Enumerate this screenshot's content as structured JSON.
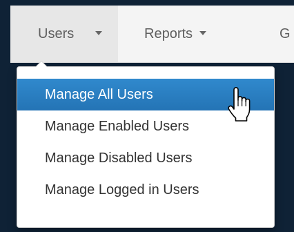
{
  "navbar": {
    "items": [
      {
        "label": "Users",
        "active": true
      },
      {
        "label": "Reports",
        "active": false
      },
      {
        "label": "G",
        "active": false
      }
    ]
  },
  "dropdown": {
    "items": [
      {
        "label": "Manage All Users",
        "highlighted": true
      },
      {
        "label": "Manage Enabled Users",
        "highlighted": false
      },
      {
        "label": "Manage Disabled Users",
        "highlighted": false
      },
      {
        "label": "Manage Logged in Users",
        "highlighted": false
      }
    ]
  },
  "colors": {
    "background": "#0f2236",
    "navbar": "#f4f4f4",
    "active_nav": "#e7e7e7",
    "highlight": "#2a7fc0"
  },
  "cursor": {
    "icon": "hand-pointer-icon"
  }
}
